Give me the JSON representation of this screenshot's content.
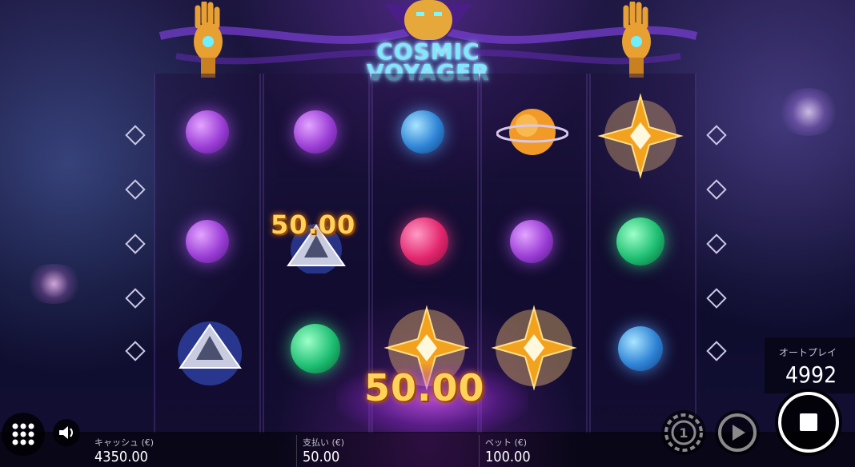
{
  "game": {
    "logo_line1": "COSMIC",
    "logo_line2": "VOYAGER"
  },
  "reels": {
    "columns": [
      [
        "purple-planet",
        "purple-planet",
        "pyramid-crystal"
      ],
      [
        "purple-planet",
        "pyramid-crystal",
        "green-planet"
      ],
      [
        "blue-planet",
        "pink-planet",
        "wild-star"
      ],
      [
        "orange-ringed-planet",
        "purple-planet",
        "wild-star"
      ],
      [
        "wild-star",
        "green-planet",
        "blue-planet"
      ]
    ]
  },
  "wins": {
    "symbol_win": "50.00",
    "total_win": "50.00"
  },
  "autoplay": {
    "label": "オートプレイ",
    "count": "4992"
  },
  "stats": {
    "cash_label": "キャッシュ (€)",
    "cash_value": "4350.00",
    "payout_label": "支払い (€)",
    "payout_value": "50.00",
    "bet_label": "ベット (€)",
    "bet_value": "100.00"
  },
  "colors": {
    "win_gold": "#ffd25a",
    "logo_cyan": "#7ee8ff",
    "accent_purple": "#9b4dff"
  }
}
